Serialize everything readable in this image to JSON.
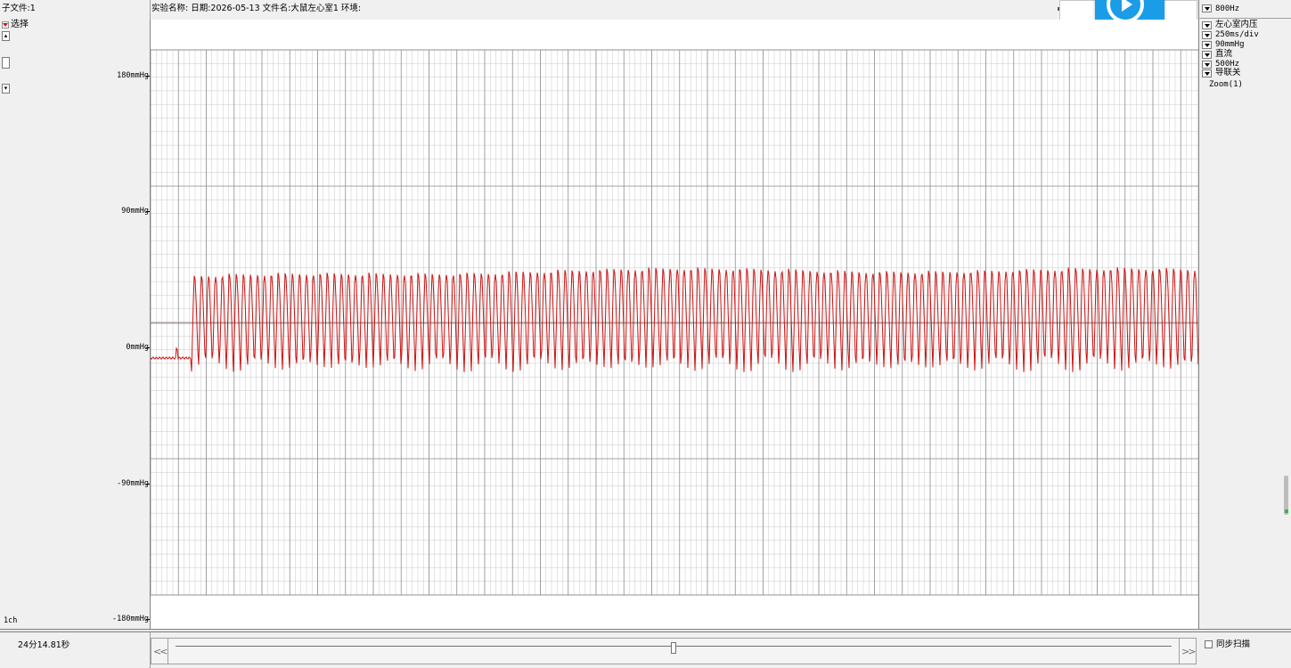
{
  "header": {
    "subfile": "子文件:1",
    "info": "实验名称:   日期:2026-05-13   文件名:大鼠左心室1 环境:"
  },
  "left_panel": {
    "select_label": "选择",
    "channel_label": "1ch"
  },
  "y_axis": {
    "labels": [
      "180mmHg",
      "90mmHg",
      "0mmHg",
      "-90mmHg",
      "-180mmHg"
    ]
  },
  "right_panel": {
    "sample_rate": "800Hz",
    "settings": [
      "左心室内压",
      "250ms/div",
      "90mmHg",
      "直流",
      "500Hz",
      "导联关"
    ],
    "zoom": "Zoom(1)"
  },
  "bottom": {
    "time": "24分14.81秒",
    "scroll_left": "<<",
    "scroll_right": ">>",
    "sync_scan_label": "同步扫描",
    "scroll_position": 0.5
  },
  "colors": {
    "signal": "#cc1111",
    "grid_minor": "#c8c8c8",
    "grid_major": "#909090",
    "play_button": "#1a9de6"
  },
  "icons": {
    "play": "play-icon"
  }
}
